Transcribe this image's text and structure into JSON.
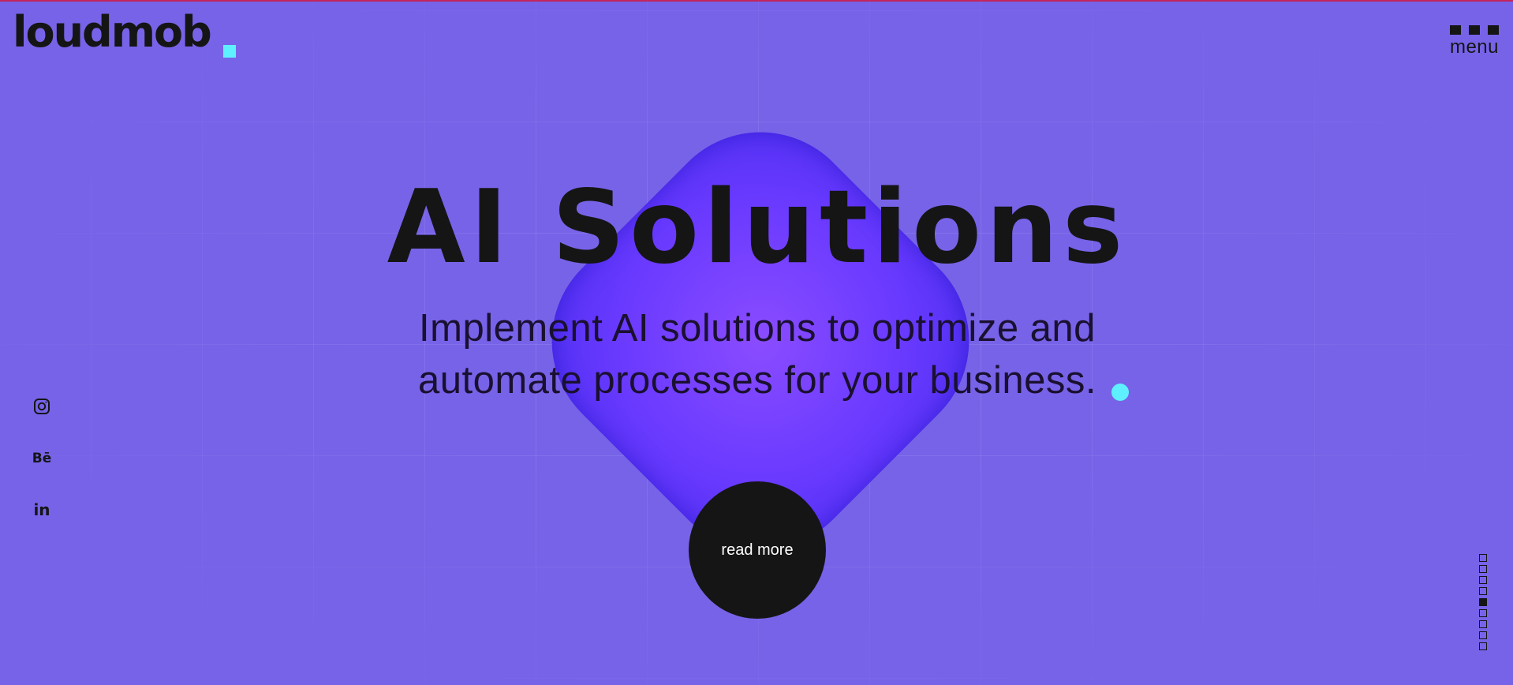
{
  "brand": {
    "logo_text": "loudmob",
    "accent": "#5ff0ff"
  },
  "header": {
    "menu_label": "menu"
  },
  "hero": {
    "title": "AI Solutions",
    "subtitle": "Implement AI solutions to optimize and automate processes for your business.",
    "cta_label": "read more"
  },
  "social": [
    {
      "name": "instagram-icon",
      "label": ""
    },
    {
      "name": "behance-icon",
      "label": "Bē"
    },
    {
      "name": "linkedin-icon",
      "label": "in"
    }
  ],
  "pager": {
    "total": 9,
    "active_index": 4
  },
  "colors": {
    "background": "#7763e8",
    "blob": "#6a3aff",
    "text": "#151515",
    "top_line": "#c2255c"
  }
}
